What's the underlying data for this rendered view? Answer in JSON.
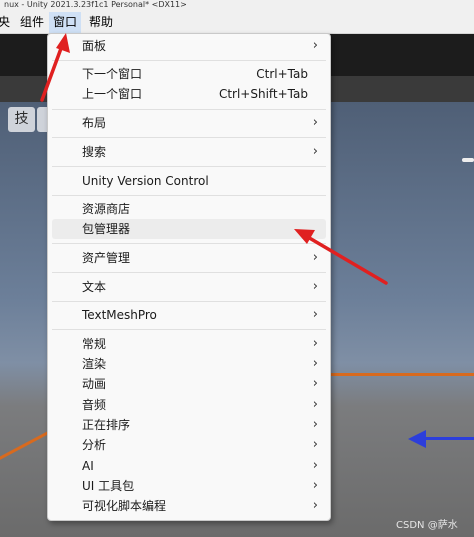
{
  "title_bar": {
    "text": "nux - Unity 2021.3.23f1c1 Personal* <DX11>"
  },
  "menu_bar": {
    "items": [
      "央",
      "组件",
      "窗口",
      "帮助"
    ]
  },
  "toolbar": {
    "tool_glyph": "技"
  },
  "window_menu": {
    "items": [
      {
        "label": "面板",
        "submenu": true
      },
      {
        "label": "下一个窗口",
        "shortcut": "Ctrl+Tab"
      },
      {
        "label": "上一个窗口",
        "shortcut": "Ctrl+Shift+Tab"
      },
      {
        "label": "布局",
        "submenu": true
      },
      {
        "label": "搜索",
        "submenu": true
      },
      {
        "label": "Unity Version Control"
      },
      {
        "label": "资源商店"
      },
      {
        "label": "包管理器",
        "highlighted": true
      },
      {
        "label": "资产管理",
        "submenu": true
      },
      {
        "label": "文本",
        "submenu": true
      },
      {
        "label": "TextMeshPro",
        "submenu": true
      },
      {
        "label": "常规",
        "submenu": true
      },
      {
        "label": "渲染",
        "submenu": true
      },
      {
        "label": "动画",
        "submenu": true
      },
      {
        "label": "音频",
        "submenu": true
      },
      {
        "label": "正在排序",
        "submenu": true
      },
      {
        "label": "分析",
        "submenu": true
      },
      {
        "label": "AI",
        "submenu": true
      },
      {
        "label": "UI 工具包",
        "submenu": true
      },
      {
        "label": "可视化脚本编程",
        "submenu": true
      }
    ]
  },
  "icons": {
    "submenu_arrow": "›"
  },
  "colors": {
    "annotation_arrow": "#e02020",
    "scene_axis_x": "#d86a1e",
    "scene_axis_blue": "#2c3edb"
  },
  "watermark": {
    "text": "CSDN @萨水"
  }
}
